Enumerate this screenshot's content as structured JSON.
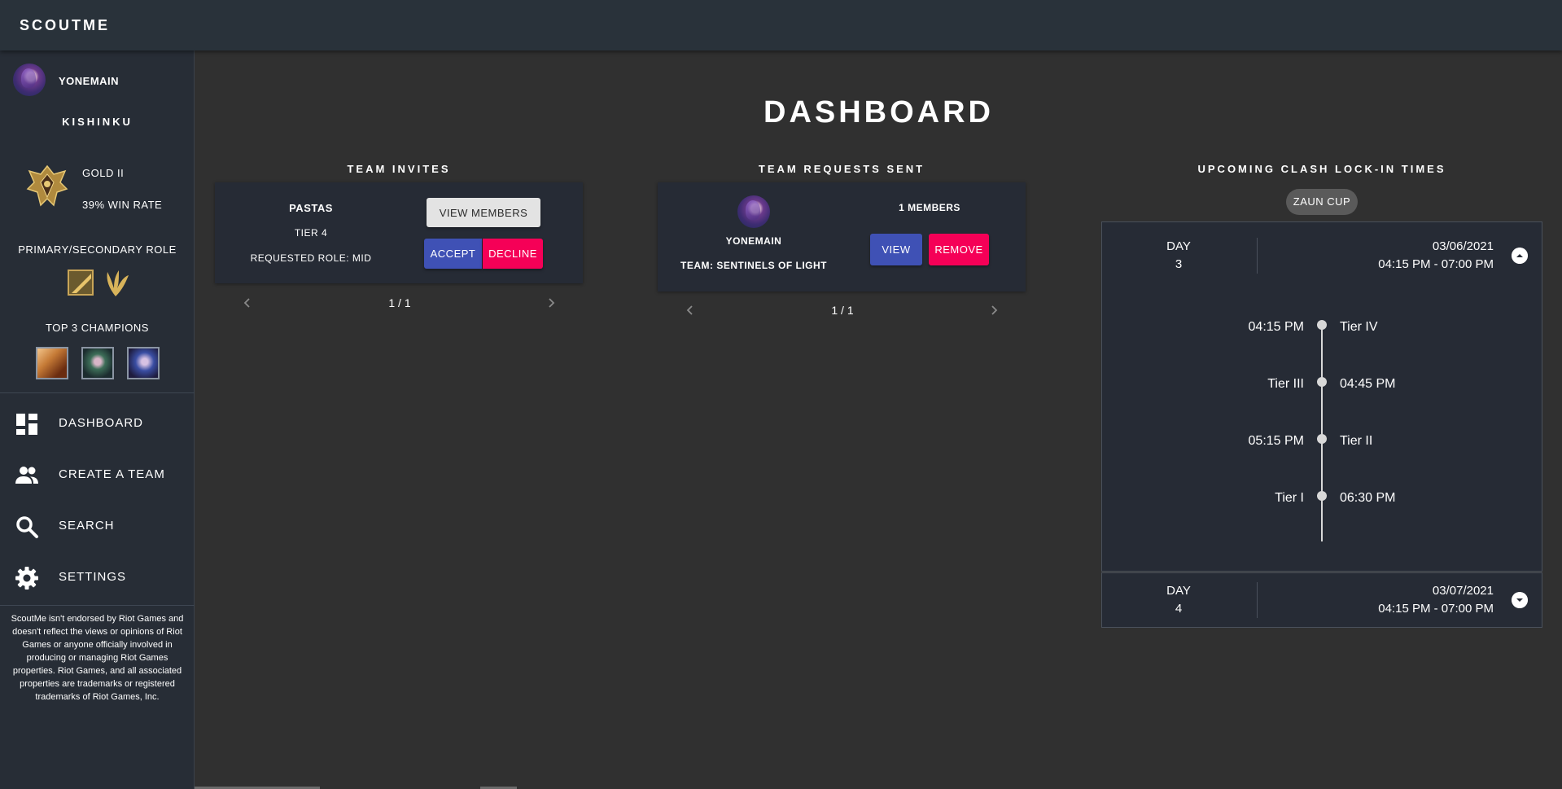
{
  "app": {
    "title": "SCOUTME"
  },
  "profile": {
    "username": "YONEMAIN",
    "server_name": "KISHINKU",
    "rank": "GOLD II",
    "win_rate": "39% WIN RATE",
    "role_title": "PRIMARY/SECONDARY ROLE",
    "champions_title": "TOP 3 CHAMPIONS"
  },
  "nav": {
    "items": [
      {
        "label": "DASHBOARD",
        "icon": "dashboard-icon"
      },
      {
        "label": "CREATE A TEAM",
        "icon": "people-icon"
      },
      {
        "label": "SEARCH",
        "icon": "search-icon"
      },
      {
        "label": "SETTINGS",
        "icon": "gear-icon"
      }
    ]
  },
  "disclaimer": "ScoutMe isn't endorsed by Riot Games and doesn't reflect the views or opinions of Riot Games or anyone officially involved in producing or managing Riot Games properties. Riot Games, and all associated properties are trademarks or registered trademarks of Riot Games, Inc.",
  "main": {
    "title": "DASHBOARD",
    "invites": {
      "title": "TEAM INVITES",
      "team_name": "PASTAS",
      "tier": "TIER 4",
      "requested_role": "REQUESTED ROLE: MID",
      "view_members_label": "VIEW MEMBERS",
      "accept_label": "ACCEPT",
      "decline_label": "DECLINE",
      "pager": "1 / 1"
    },
    "requests": {
      "title": "TEAM REQUESTS SENT",
      "username": "YONEMAIN",
      "team": "TEAM: SENTINELS OF LIGHT",
      "members": "1 MEMBERS",
      "view_label": "VIEW",
      "remove_label": "REMOVE",
      "pager": "1 / 1"
    },
    "clash": {
      "title": "UPCOMING CLASH LOCK-IN TIMES",
      "cup_chip": "ZAUN CUP",
      "days": [
        {
          "day_label": "DAY",
          "day_number": "3",
          "date": "03/06/2021",
          "time_range": "04:15 PM - 07:00 PM",
          "expanded": true,
          "timeline": [
            {
              "time": "04:15 PM",
              "tier": "Tier IV"
            },
            {
              "time": "04:45 PM",
              "tier": "Tier III"
            },
            {
              "time": "05:15 PM",
              "tier": "Tier II"
            },
            {
              "time": "06:30 PM",
              "tier": "Tier I"
            }
          ]
        },
        {
          "day_label": "DAY",
          "day_number": "4",
          "date": "03/07/2021",
          "time_range": "04:15 PM - 07:00 PM",
          "expanded": false
        }
      ]
    }
  },
  "colors": {
    "topbar": "#29323a",
    "sidebar": "#272d36",
    "background": "#303030",
    "card": "#262b35",
    "primary": "#3f51b5",
    "secondary": "#f50057",
    "chip": "#5a5a5a"
  }
}
